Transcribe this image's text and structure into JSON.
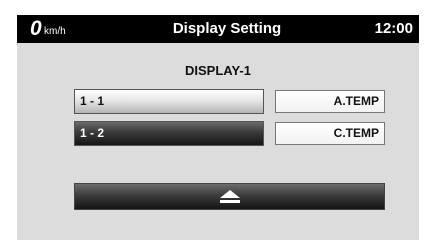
{
  "status_bar": {
    "speed_value": "0",
    "speed_unit": "km/h",
    "title": "Display Setting",
    "clock": "12:00"
  },
  "main": {
    "heading": "DISPLAY-1",
    "rows": [
      {
        "label": "1 - 1",
        "value": "A.TEMP",
        "selected": false
      },
      {
        "label": "1 - 2",
        "value": "C.TEMP",
        "selected": true
      }
    ],
    "eject_icon": "eject-icon"
  }
}
